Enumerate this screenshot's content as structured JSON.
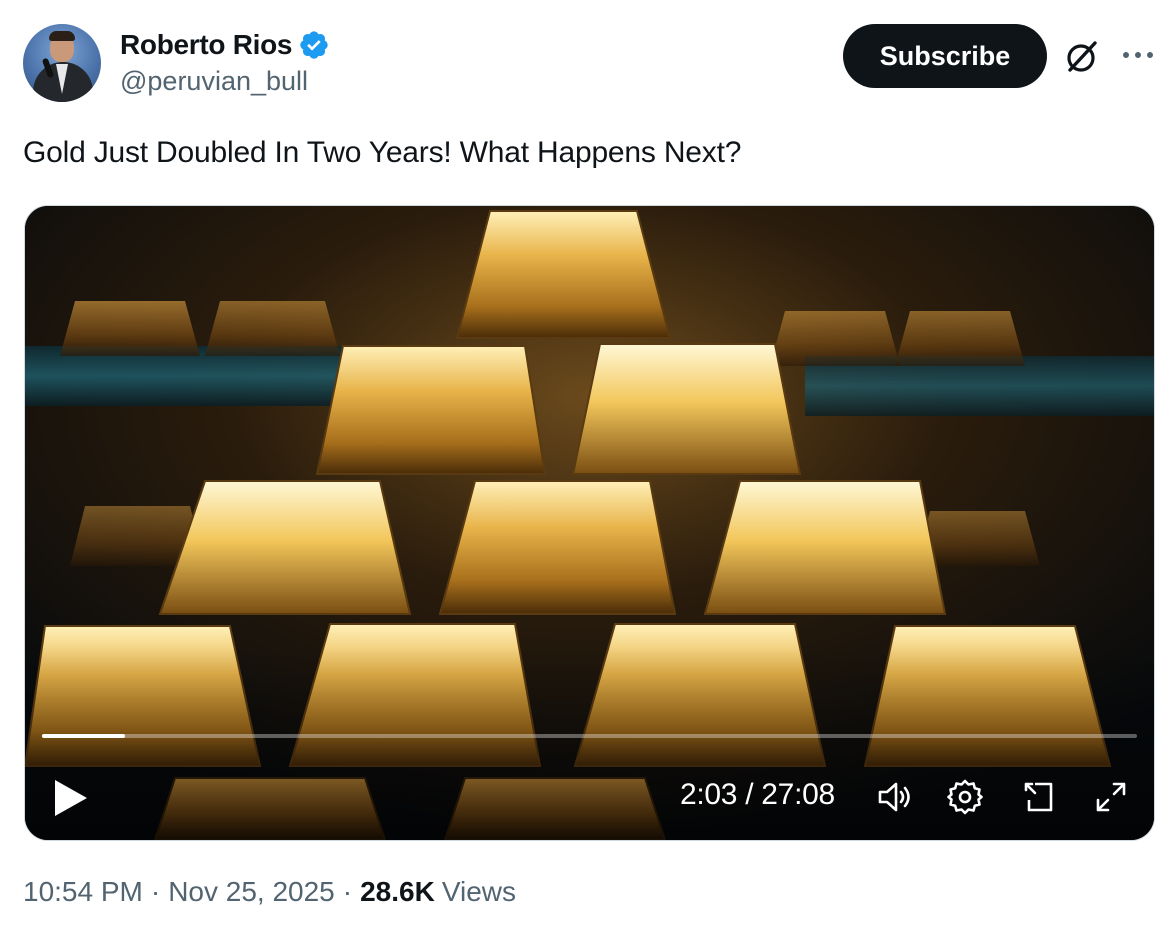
{
  "author": {
    "display_name": "Roberto Rios",
    "handle": "@peruvian_bull",
    "verified": true,
    "verified_color": "#1d9bf0",
    "avatar_icon": "avatar-photo"
  },
  "header": {
    "subscribe_label": "Subscribe",
    "grok_icon": "grok-icon",
    "more_icon": "more-icon"
  },
  "tweet": {
    "text": "Gold Just Doubled In Two Years! What Happens Next?"
  },
  "video": {
    "current_time": "2:03",
    "duration": "27:08",
    "time_display": "2:03 / 27:08",
    "progress_fraction": 0.0756,
    "controls": [
      "play-icon",
      "volume-icon",
      "settings-icon",
      "pip-icon",
      "fullscreen-icon"
    ]
  },
  "meta": {
    "time": "10:54 PM",
    "separator": "·",
    "date": "Nov 25, 2025",
    "views_count": "28.6K",
    "views_label": "Views"
  },
  "colors": {
    "text_primary": "#0f1419",
    "text_secondary": "#536471",
    "button_bg": "#0f1419",
    "border": "#cfd9de"
  }
}
